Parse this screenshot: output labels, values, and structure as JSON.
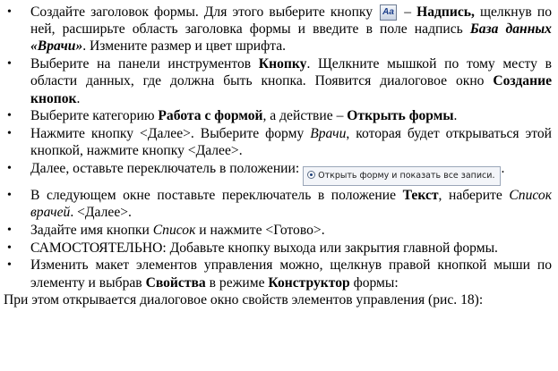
{
  "bullet_glyph": "•",
  "items": [
    {
      "parts": [
        {
          "t": "Создайте заголовок формы. Для этого выберите кнопку "
        },
        {
          "icon": "Aa"
        },
        {
          "t": " – "
        },
        {
          "t": "Надпись,",
          "s": "b"
        },
        {
          "t": " щелкнув по ней, расширьте область заголовка формы и введите в поле надпись "
        },
        {
          "t": "База данных «Врачи»",
          "s": "bi"
        },
        {
          "t": ". Измените размер и цвет шрифта."
        }
      ]
    },
    {
      "parts": [
        {
          "t": "Выберите на панели инструментов "
        },
        {
          "t": "Кнопку",
          "s": "b"
        },
        {
          "t": ". Щелкните мышкой по тому месту в области данных, где должна быть кнопка. Появится диалоговое окно "
        },
        {
          "t": "Создание кнопок",
          "s": "b"
        },
        {
          "t": "."
        }
      ]
    },
    {
      "parts": [
        {
          "t": "Выберите категорию "
        },
        {
          "t": "Работа с формой",
          "s": "b"
        },
        {
          "t": ", а действие – "
        },
        {
          "t": "Открыть формы",
          "s": "b"
        },
        {
          "t": "."
        }
      ]
    },
    {
      "parts": [
        {
          "t": "Нажмите кнопку <Далее>. Выберите форму "
        },
        {
          "t": "Врачи",
          "s": "i"
        },
        {
          "t": ", которая будет открываться этой кнопкой, нажмите кнопку <Далее>."
        }
      ]
    },
    {
      "parts": [
        {
          "t": "Далее, оставьте переключатель в положении: "
        },
        {
          "switch": "Открыть форму и показать все записи."
        },
        {
          "t": "."
        }
      ]
    },
    {
      "parts": [
        {
          "t": "В следующем окне поставьте переключатель в положение "
        },
        {
          "t": "Текст",
          "s": "b"
        },
        {
          "t": ", наберите "
        },
        {
          "t": "Список врачей",
          "s": "i"
        },
        {
          "t": ". <Далее>."
        }
      ]
    },
    {
      "parts": [
        {
          "t": "Задайте имя кнопки "
        },
        {
          "t": "Список",
          "s": "i"
        },
        {
          "t": " и нажмите <Готово>."
        }
      ]
    },
    {
      "parts": [
        {
          "t": "САМОСТОЯТЕЛЬНО: Добавьте кнопку выхода или закрытия главной формы."
        }
      ]
    },
    {
      "parts": [
        {
          "t": "Изменить макет элементов управления можно, щелкнув правой кнопкой мыши по элементу и выбрав "
        },
        {
          "t": "Свойства",
          "s": "b"
        },
        {
          "t": " в режиме "
        },
        {
          "t": "Конструктор",
          "s": "b"
        },
        {
          "t": " формы:"
        }
      ]
    }
  ],
  "final_paragraph": "При этом открывается диалоговое окно свойств элементов управления (рис. 18):"
}
